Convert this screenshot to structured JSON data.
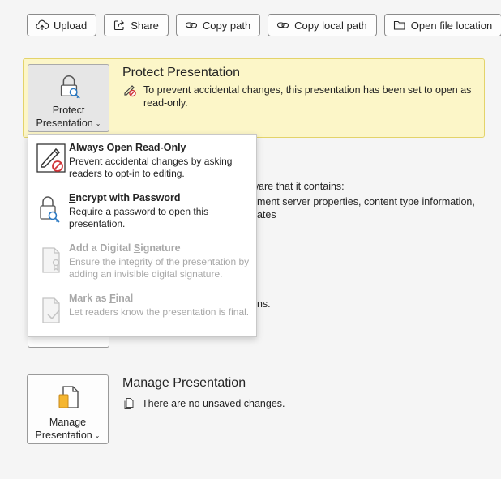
{
  "toolbar": {
    "buttons": [
      {
        "label": "Upload",
        "icon": "upload-icon"
      },
      {
        "label": "Share",
        "icon": "share-icon"
      },
      {
        "label": "Copy path",
        "icon": "link-icon"
      },
      {
        "label": "Copy local path",
        "icon": "link-icon"
      },
      {
        "label": "Open file location",
        "icon": "folder-icon"
      }
    ]
  },
  "protect": {
    "button_line1": "Protect",
    "button_line2": "Presentation",
    "title": "Protect Presentation",
    "message": "To prevent accidental changes, this presentation has been set to open as read-only."
  },
  "inspect_partial": {
    "line1": "ware that it contains:",
    "line2": "ument server properties, content type information,",
    "line3": "dates",
    "line4": "ons."
  },
  "dropdown": {
    "items": [
      {
        "title_pre": "Always ",
        "title_key": "O",
        "title_post": "pen Read-Only",
        "desc": "Prevent accidental changes by asking readers to opt-in to editing.",
        "enabled": true
      },
      {
        "title_pre": "",
        "title_key": "E",
        "title_post": "ncrypt with Password",
        "desc": "Require a password to open this presentation.",
        "enabled": true
      },
      {
        "title_pre": "Add a Digital ",
        "title_key": "S",
        "title_post": "ignature",
        "desc": "Ensure the integrity of the presentation by adding an invisible digital signature.",
        "enabled": false
      },
      {
        "title_pre": "Mark as ",
        "title_key": "F",
        "title_post": "inal",
        "desc": "Let readers know the presentation is final.",
        "enabled": false
      }
    ]
  },
  "manage": {
    "button_line1": "Manage",
    "button_line2": "Presentation",
    "title": "Manage Presentation",
    "status": "There are no unsaved changes."
  },
  "colors": {
    "accent_blue": "#2b79c2",
    "warning_band": "#fcf6c8",
    "disabled_text": "#a8a8a8"
  }
}
